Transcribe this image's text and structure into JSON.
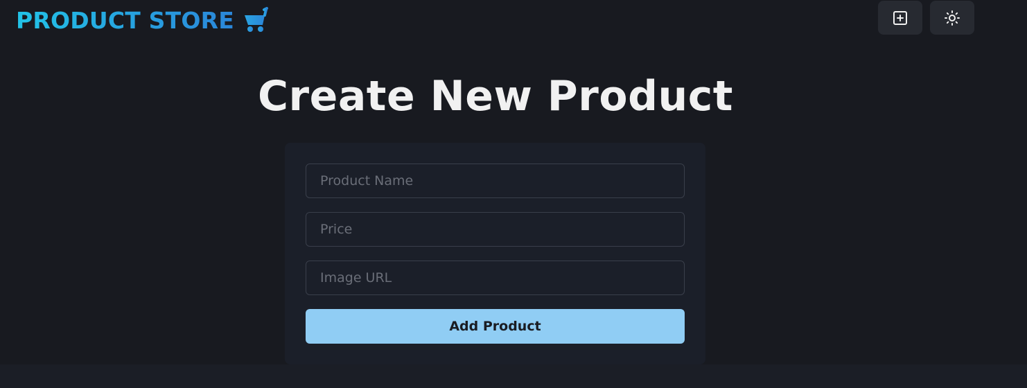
{
  "header": {
    "brand_text": "PRODUCT STORE",
    "brand_icon": "shopping-cart-icon",
    "create_button_icon": "plus-square-icon",
    "theme_button_icon": "sun-icon"
  },
  "main": {
    "title": "Create New Product",
    "form": {
      "name_placeholder": "Product Name",
      "name_value": "",
      "price_placeholder": "Price",
      "price_value": "",
      "image_placeholder": "Image URL",
      "image_value": "",
      "submit_label": "Add Product"
    }
  },
  "colors": {
    "background": "#181a20",
    "card": "#1b1f29",
    "accent_gradient_start": "#22c3e7",
    "accent_gradient_end": "#2b86d9",
    "button": "#90cdf4",
    "icon_button": "#272a31"
  }
}
